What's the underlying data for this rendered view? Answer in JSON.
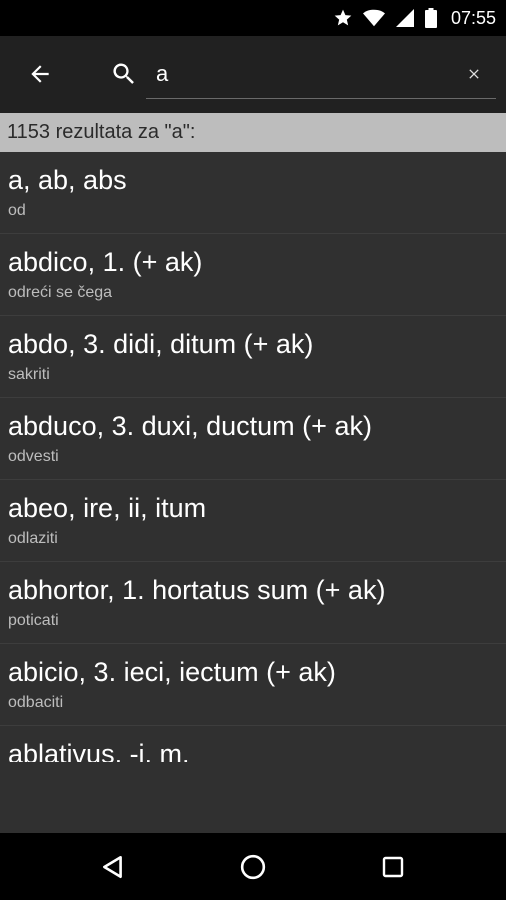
{
  "status_bar": {
    "time": "07:55",
    "icons": [
      "star-icon",
      "wifi-icon",
      "signal-icon",
      "battery-icon"
    ]
  },
  "toolbar": {
    "back_icon": "arrow-left-icon",
    "search_icon": "search-icon",
    "query": "a",
    "clear_icon": "close-icon"
  },
  "results_header": "1153 rezultata za \"a\":",
  "results": [
    {
      "term": "a, ab, abs",
      "translation": "od"
    },
    {
      "term": "abdico, 1.  (+ ak)",
      "translation": "odreći se čega"
    },
    {
      "term": "abdo, 3. didi, ditum  (+ ak)",
      "translation": "sakriti"
    },
    {
      "term": "abduco, 3. duxi, ductum  (+ ak)",
      "translation": "odvesti"
    },
    {
      "term": "abeo, ire, ii, itum",
      "translation": "odlaziti"
    },
    {
      "term": "abhortor, 1. hortatus sum  (+ ak)",
      "translation": "poticati"
    },
    {
      "term": "abicio, 3. ieci, iectum  (+ ak)",
      "translation": "odbaciti"
    },
    {
      "term": "ablativus, -i, m.",
      "translation": ""
    }
  ],
  "nav_bar": {
    "icons": [
      "back-triangle-icon",
      "home-circle-icon",
      "recents-square-icon"
    ]
  },
  "colors": {
    "background": "#303030",
    "toolbar": "#212121",
    "header": "#bdbdbd",
    "system_bars": "#000000"
  }
}
